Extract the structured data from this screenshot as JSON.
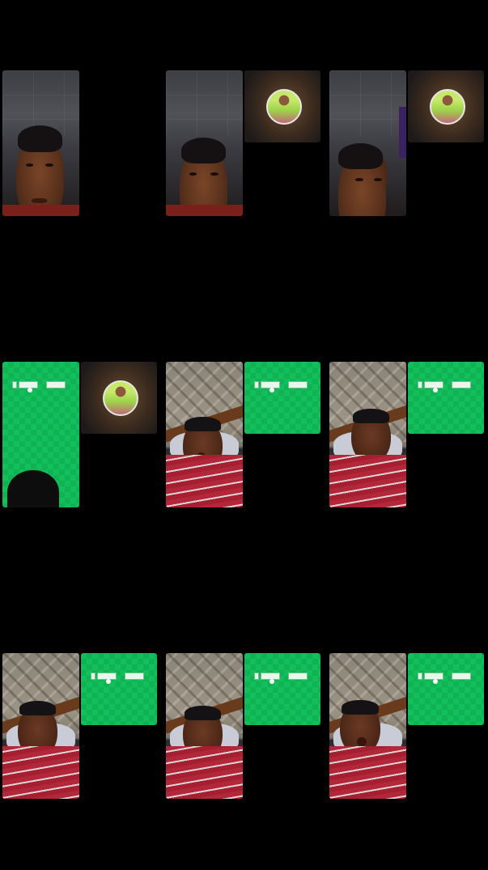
{
  "grid": {
    "rows": 3,
    "cols": 3
  },
  "frames": [
    {
      "main": "woman-face-room",
      "thumbnail": "none"
    },
    {
      "main": "woman-face-room",
      "thumbnail": "selfie-circle"
    },
    {
      "main": "woman-face-room",
      "thumbnail": "selfie-circle"
    },
    {
      "main": "green-screen",
      "thumbnail": "selfie-circle"
    },
    {
      "main": "man-in-bed",
      "thumbnail": "green-screen"
    },
    {
      "main": "man-in-bed",
      "thumbnail": "green-screen"
    },
    {
      "main": "man-in-bed",
      "thumbnail": "green-screen"
    },
    {
      "main": "man-in-bed",
      "thumbnail": "green-screen"
    },
    {
      "main": "man-in-bed",
      "thumbnail": "green-screen"
    }
  ],
  "colors": {
    "background": "#000000",
    "green_screen": "#11c05a",
    "shirt_red": "#b2283a"
  }
}
